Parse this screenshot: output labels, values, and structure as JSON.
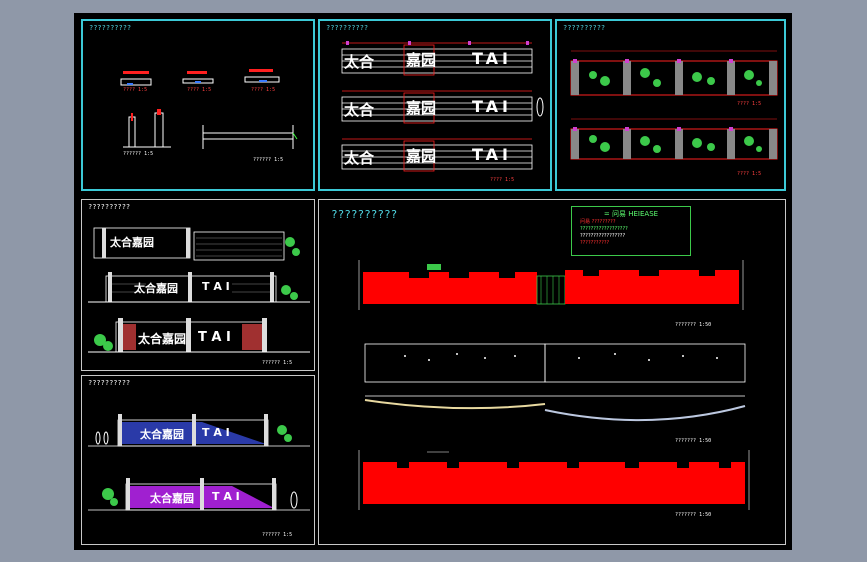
{
  "panels": {
    "p1_title": "??????????",
    "p2_title": "??????????",
    "p3_title": "??????????",
    "p4_title": "??????????",
    "p5_title": "??????????",
    "p6_title": "??????????"
  },
  "sign": {
    "name_a": "太合",
    "name_b": "嘉园",
    "full": "太合嘉园",
    "latin": "TAI",
    "latin_spaced": "T A I"
  },
  "legend": {
    "heading": "= 问易  HEIEASE",
    "line1": "问易  ?????????",
    "line2": "??????????????????",
    "line3": "?????????????????",
    "line4": "???????????"
  },
  "labels": {
    "scale_red": "???? 1:5",
    "scale_white": "??????? 1:50",
    "scale_small": "?????? 1:5"
  },
  "colors": {
    "frame": "#3cc9d6",
    "wall": "#ff0000",
    "sheet": "#000000",
    "background": "#8f98a8"
  }
}
